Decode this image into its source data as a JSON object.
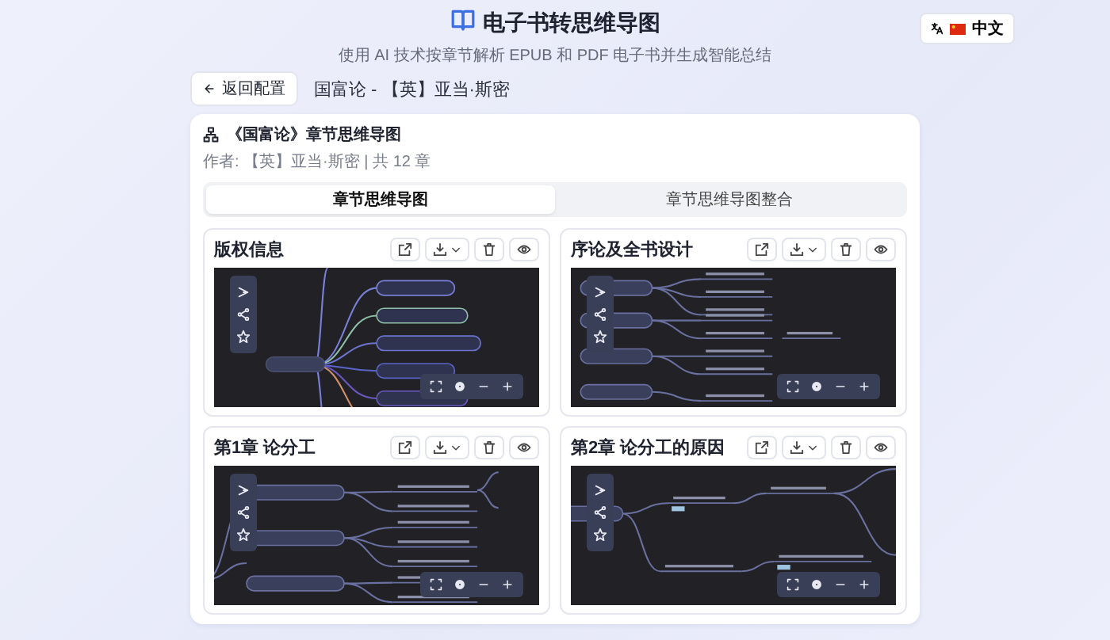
{
  "header": {
    "title": "电子书转思维导图",
    "subtitle": "使用 AI 技术按章节解析 EPUB 和 PDF 电子书并生成智能总结",
    "language_button": "中文"
  },
  "nav": {
    "back_button": "返回配置",
    "book_title": "国富论 - 【英】亚当·斯密"
  },
  "panel": {
    "title": "《国富论》章节思维导图",
    "meta": "作者: 【英】亚当·斯密 | 共 12 章",
    "tabs": [
      {
        "label": "章节思维导图",
        "selected": true
      },
      {
        "label": "章节思维导图整合",
        "selected": false
      }
    ]
  },
  "chapters": [
    {
      "title": "版权信息"
    },
    {
      "title": "序论及全书设计"
    },
    {
      "title": "第1章 论分工"
    },
    {
      "title": "第2章 论分工的原因"
    }
  ]
}
